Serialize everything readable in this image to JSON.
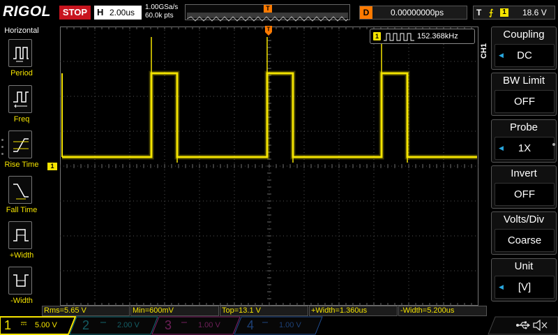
{
  "header": {
    "logo": "RIGOL",
    "run_state": "STOP",
    "horizontal_tag": "H",
    "timebase": "2.00us",
    "sample_rate": "1.00GSa/s",
    "memory_depth": "60.0k pts",
    "trigger_marker": "T",
    "delay_tag": "D",
    "delay_value": "0.00000000ps",
    "trigger_tag": "T",
    "trigger_edge_glyph": "⨍",
    "trigger_source": "1",
    "trigger_level": "18.6 V"
  },
  "left_menu": {
    "title": "Horizontal",
    "items": [
      {
        "label": "Period",
        "icon": "period-icon"
      },
      {
        "label": "Freq",
        "icon": "freq-icon"
      },
      {
        "label": "Rise Time",
        "icon": "rise-time-icon"
      },
      {
        "label": "Fall Time",
        "icon": "fall-time-icon"
      },
      {
        "label": "+Width",
        "icon": "pos-width-icon"
      },
      {
        "label": "-Width",
        "icon": "neg-width-icon"
      }
    ]
  },
  "scope": {
    "channel_marker": "1",
    "trigger_position_marker": "T",
    "frequency_counter": {
      "channel": "1",
      "value": "152.368kHz"
    },
    "channel_tab": "CH1"
  },
  "right_menu": {
    "items": [
      {
        "title": "Coupling",
        "value": "DC",
        "has_arrow": true
      },
      {
        "title": "BW Limit",
        "value": "OFF",
        "has_arrow": false
      },
      {
        "title": "Probe",
        "value": "1X",
        "has_arrow": true
      },
      {
        "title": "Invert",
        "value": "OFF",
        "has_arrow": false
      },
      {
        "title": "Volts/Div",
        "value": "Coarse",
        "has_arrow": false
      },
      {
        "title": "Unit",
        "value": "[V]",
        "has_arrow": true
      }
    ]
  },
  "measurements": [
    {
      "label": "Rms=5.65 V"
    },
    {
      "label": "Min=600mV"
    },
    {
      "label": "Top=13.1 V"
    },
    {
      "label": "+Width=1.360us"
    },
    {
      "label": "-Width=5.200us"
    }
  ],
  "channels": [
    {
      "number": "1",
      "scale": "5.00 V",
      "active": true,
      "color": "#f5e400"
    },
    {
      "number": "2",
      "scale": "2.00 V",
      "active": false,
      "color": "#1fa3b0"
    },
    {
      "number": "3",
      "scale": "1.00 V",
      "active": false,
      "color": "#c0349a"
    },
    {
      "number": "4",
      "scale": "1.00 V",
      "active": false,
      "color": "#2f6fd0"
    }
  ],
  "colors": {
    "ch1": "#f5e400",
    "stop": "#c8141e",
    "trigger_marker": "#ff7a00",
    "menu_arrow": "#29a8e0"
  }
}
